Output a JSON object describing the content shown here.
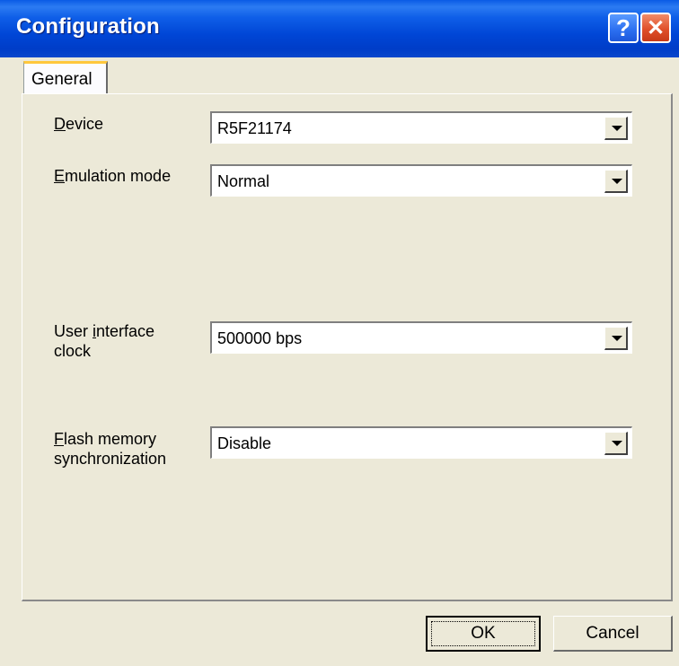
{
  "window": {
    "title": "Configuration"
  },
  "titlebar": {
    "help_label": "?",
    "close_label": "✕"
  },
  "tabs": [
    {
      "label": "General"
    }
  ],
  "fields": {
    "device": {
      "label_first": "D",
      "label_rest": "evice",
      "value": "R5F21174"
    },
    "emulation_mode": {
      "label_first": "E",
      "label_rest": "mulation mode",
      "value": "Normal"
    },
    "user_interface_clock": {
      "label_line1_pre": "User ",
      "label_line1_u": "i",
      "label_line1_post": "nterface",
      "label_line2": "clock",
      "value": "500000 bps"
    },
    "flash_memory_sync": {
      "label_line1_u": "F",
      "label_line1_post": "lash memory",
      "label_line2": "synchronization",
      "value": "Disable"
    }
  },
  "buttons": {
    "ok": "OK",
    "cancel": "Cancel"
  }
}
